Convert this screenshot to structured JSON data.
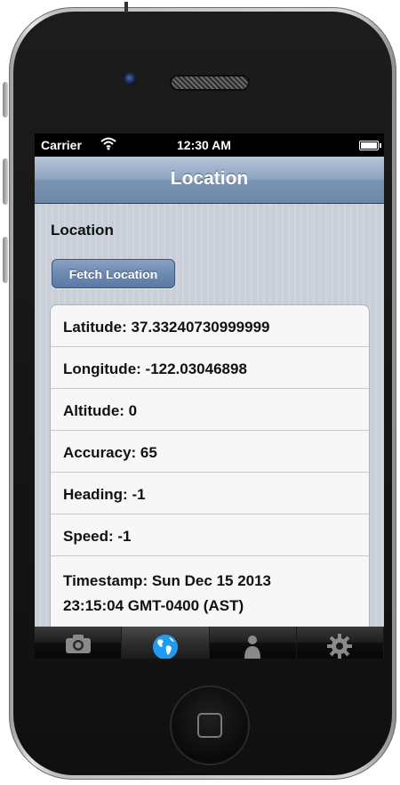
{
  "status_bar": {
    "carrier": "Carrier",
    "time": "12:30 AM"
  },
  "nav": {
    "title": "Location"
  },
  "section": {
    "label": "Location",
    "fetch_button": "Fetch Location"
  },
  "info": {
    "latitude": "Latitude: 37.33240730999999",
    "longitude": "Longitude: -122.03046898",
    "altitude": "Altitude: 0",
    "accuracy": "Accuracy: 65",
    "heading": "Heading: -1",
    "speed": "Speed: -1",
    "timestamp_line1": "Timestamp: Sun Dec 15 2013",
    "timestamp_line2": "23:15:04 GMT-0400 (AST)"
  },
  "tab_bar": {
    "tabs": [
      {
        "icon": "camera-icon",
        "selected": false
      },
      {
        "icon": "globe-icon",
        "selected": true
      },
      {
        "icon": "person-icon",
        "selected": false
      },
      {
        "icon": "gear-icon",
        "selected": false
      }
    ]
  },
  "colors": {
    "nav_bar": "#7a93b2",
    "accent_blue": "#1f9cf0",
    "tab_bar": "#0e0e0e"
  }
}
